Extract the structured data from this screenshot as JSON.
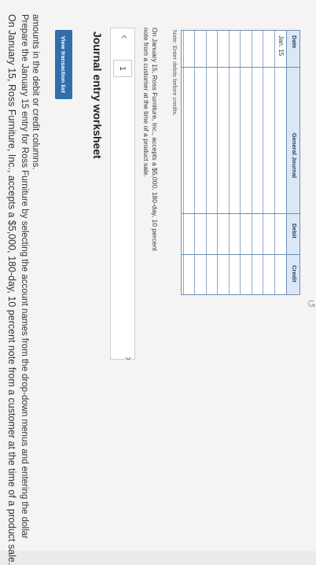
{
  "question": {
    "line1": "On January 15, Ross Furniture, Inc., accepts a $5,000, 180-day, 10 percent note from a customer at the time of a product sale.",
    "line2": "Prepare the January 15 entry for Ross Furniture by selecting the account names from the drop-down menus and entering the dollar",
    "line3": "amounts in the debit or credit columns."
  },
  "view_button": "View transaction list",
  "worksheet_title": "Journal entry worksheet",
  "nav": {
    "page": "1"
  },
  "description": "On January 15, Ross Furniture, Inc., accepts a $5,000, 180-day, 10 percent note from a customer at the time of a product sale.",
  "note": "Note: Enter debits before credits.",
  "table": {
    "headers": {
      "date": "Date",
      "account": "General Journal",
      "debit": "Debit",
      "credit": "Credit"
    },
    "first_date": "Jan. 15",
    "rows": 9
  }
}
